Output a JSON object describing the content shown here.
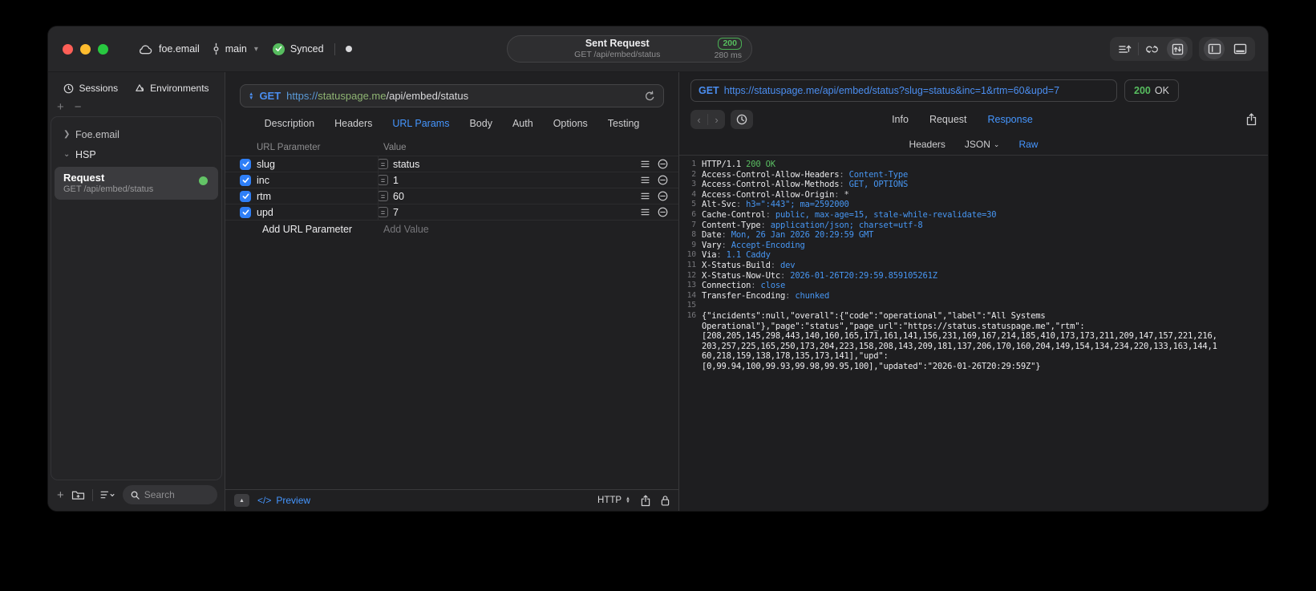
{
  "colors": {
    "accent": "#4596ff",
    "method_blue": "#4b8ef0",
    "host_green": "#8fb573",
    "success_green": "#57bd5f",
    "checkbox_blue": "#2f7ff7",
    "traffic_red": "#ff5f57",
    "traffic_yellow": "#febc2e",
    "traffic_green": "#28c840"
  },
  "titlebar": {
    "project": "foe.email",
    "branch": "main",
    "sync_label": "Synced",
    "center": {
      "title": "Sent Request",
      "subtitle": "GET /api/embed/status",
      "status_code": "200",
      "duration": "280 ms"
    }
  },
  "sidebar": {
    "tabs": [
      {
        "label": "Sessions",
        "icon": "clock-icon"
      },
      {
        "label": "Environments",
        "icon": "environments-icon"
      }
    ],
    "tree": {
      "group1": "Foe.email",
      "group2": "HSP",
      "request": {
        "title": "Request",
        "subtitle": "GET /api/embed/status"
      }
    },
    "search_placeholder": "Search"
  },
  "request_editor": {
    "method_label": "GET",
    "url": {
      "scheme": "https://",
      "host": "statuspage.me",
      "path": "/api/embed/status"
    },
    "tabs": [
      "Description",
      "Headers",
      "URL Params",
      "Body",
      "Auth",
      "Options",
      "Testing"
    ],
    "active_tab": "URL Params",
    "params": {
      "columns": {
        "name": "URL Parameter",
        "value": "Value"
      },
      "rows": [
        {
          "name": "slug",
          "value": "status",
          "enabled": true
        },
        {
          "name": "inc",
          "value": "1",
          "enabled": true
        },
        {
          "name": "rtm",
          "value": "60",
          "enabled": true
        },
        {
          "name": "upd",
          "value": "7",
          "enabled": true
        }
      ],
      "add_row": {
        "name_placeholder": "Add URL Parameter",
        "value_placeholder": "Add Value"
      }
    },
    "footer": {
      "code_glyph": "</>",
      "preview_label": "Preview",
      "protocol_label": "HTTP"
    }
  },
  "response_viewer": {
    "request_line": {
      "method": "GET",
      "url": "https://statuspage.me/api/embed/status?slug=status&inc=1&rtm=60&upd=7"
    },
    "status_badge": {
      "code": "200",
      "text": "OK"
    },
    "tabs": [
      "Info",
      "Request",
      "Response"
    ],
    "active_tab": "Response",
    "view_tabs": [
      {
        "label": "Headers"
      },
      {
        "label": "JSON",
        "dropdown": true
      },
      {
        "label": "Raw"
      }
    ],
    "active_view_tab": "Raw",
    "code": {
      "status_line": {
        "num": 1,
        "protocol": "HTTP/1.1 ",
        "status": "200 OK"
      },
      "headers": [
        {
          "num": 2,
          "name": "Access-Control-Allow-Headers",
          "value": "Content-Type"
        },
        {
          "num": 3,
          "name": "Access-Control-Allow-Methods",
          "value": "GET, OPTIONS"
        },
        {
          "num": 4,
          "name": "Access-Control-Allow-Origin",
          "value": "*",
          "plain": true
        },
        {
          "num": 5,
          "name": "Alt-Svc",
          "value": "h3=\":443\"; ma=2592000"
        },
        {
          "num": 6,
          "name": "Cache-Control",
          "value": "public, max-age=15, stale-while-revalidate=30"
        },
        {
          "num": 7,
          "name": "Content-Type",
          "value": "application/json; charset=utf-8"
        },
        {
          "num": 8,
          "name": "Date",
          "value": "Mon, 26 Jan 2026 20:29:59 GMT"
        },
        {
          "num": 9,
          "name": "Vary",
          "value": "Accept-Encoding"
        },
        {
          "num": 10,
          "name": "Via",
          "value": "1.1 Caddy"
        },
        {
          "num": 11,
          "name": "X-Status-Build",
          "value": "dev"
        },
        {
          "num": 12,
          "name": "X-Status-Now-Utc",
          "value": "2026-01-26T20:29:59.859105261Z"
        },
        {
          "num": 13,
          "name": "Connection",
          "value": "close"
        },
        {
          "num": 14,
          "name": "Transfer-Encoding",
          "value": "chunked"
        }
      ],
      "blank_line_num": 15,
      "body_start_num": 16,
      "body_lines": [
        "{\"incidents\":null,\"overall\":{\"code\":\"operational\",\"label\":\"All Systems",
        "Operational\"},\"page\":\"status\",\"page_url\":\"https://status.statuspage.me\",\"rtm\":",
        "[208,205,145,298,443,140,160,165,171,161,141,156,231,169,167,214,185,410,173,173,211,209,147,157,221,216,",
        "203,257,225,165,250,173,204,223,158,208,143,209,181,137,206,170,160,204,149,154,134,234,220,133,163,144,1",
        "60,218,159,138,178,135,173,141],\"upd\":",
        "[0,99.94,100,99.93,99.98,99.95,100],\"updated\":\"2026-01-26T20:29:59Z\"}"
      ]
    }
  }
}
